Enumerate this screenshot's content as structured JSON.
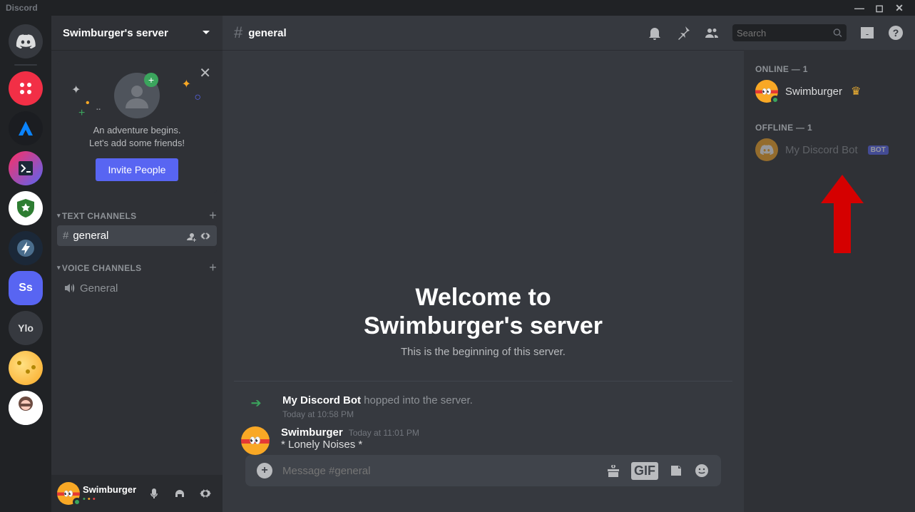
{
  "app_title": "Discord",
  "server": {
    "name": "Swimburger's server"
  },
  "invite_card": {
    "line1": "An adventure begins.",
    "line2": "Let's add some friends!",
    "button": "Invite People"
  },
  "categories": {
    "text": {
      "label": "TEXT CHANNELS"
    },
    "voice": {
      "label": "VOICE CHANNELS"
    }
  },
  "channels": {
    "text": [
      {
        "name": "general",
        "active": true
      }
    ],
    "voice": [
      {
        "name": "General"
      }
    ]
  },
  "current_user": {
    "name": "Swimburger",
    "tag_dots": "•  •  •"
  },
  "channel_header": {
    "name": "general"
  },
  "search": {
    "placeholder": "Search"
  },
  "welcome": {
    "title_l1": "Welcome to",
    "title_l2": "Swimburger's server",
    "subtitle": "This is the beginning of this server."
  },
  "messages": [
    {
      "type": "system",
      "actor": "My Discord Bot",
      "text": "hopped into the server.",
      "time": "Today at 10:58 PM"
    },
    {
      "type": "user",
      "author": "Swimburger",
      "time": "Today at 11:01 PM",
      "body": "* Lonely Noises *"
    }
  ],
  "composer": {
    "placeholder": "Message #general"
  },
  "members": {
    "online": {
      "label": "ONLINE — 1",
      "items": [
        {
          "name": "Swimburger",
          "owner": true
        }
      ]
    },
    "offline": {
      "label": "OFFLINE — 1",
      "items": [
        {
          "name": "My Discord Bot",
          "bot": true,
          "bot_tag": "BOT"
        }
      ]
    }
  },
  "guild_icons": {
    "selected_initials": "Ss",
    "ylo": "Ylo"
  }
}
